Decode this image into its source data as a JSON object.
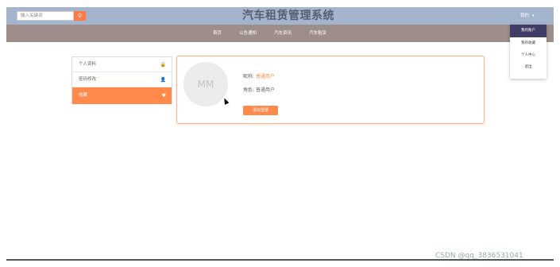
{
  "header": {
    "search": {
      "placeholder": "输入关键词",
      "button_glyph": "⚲"
    },
    "title": "汽车租赁管理系统",
    "user_menu": {
      "label": "我的",
      "caret": "▾"
    }
  },
  "nav": {
    "items": [
      {
        "label": "首页"
      },
      {
        "label": "公告通知"
      },
      {
        "label": "汽车资讯"
      },
      {
        "label": "汽车租赁"
      }
    ]
  },
  "dropdown": {
    "items": [
      {
        "label": "我的账户",
        "active": true
      },
      {
        "label": "我的收藏",
        "active": false
      },
      {
        "label": "个人中心",
        "active": false
      },
      {
        "label": "退出",
        "active": false
      }
    ]
  },
  "sidebar": {
    "items": [
      {
        "label": "个人资料",
        "icon": "lock-icon",
        "glyph": "🔒",
        "active": false
      },
      {
        "label": "密码修改",
        "icon": "user-icon",
        "glyph": "👤",
        "active": false
      },
      {
        "label": "收藏",
        "icon": "heart-icon",
        "glyph": "♥",
        "active": true
      }
    ]
  },
  "profile": {
    "avatar_text": "MM",
    "nickname_label": "昵称:",
    "nickname_value": "普通用户",
    "role_label": "角色:",
    "role_value": "普通用户",
    "logout_label": "退出登录"
  },
  "colors": {
    "topbar": "#a4b4cd",
    "navbar": "#9d8e8b",
    "accent": "#ff8a4c",
    "dropdown_active": "#3f3d66"
  },
  "watermark": "CSDN @qq_3836531041"
}
